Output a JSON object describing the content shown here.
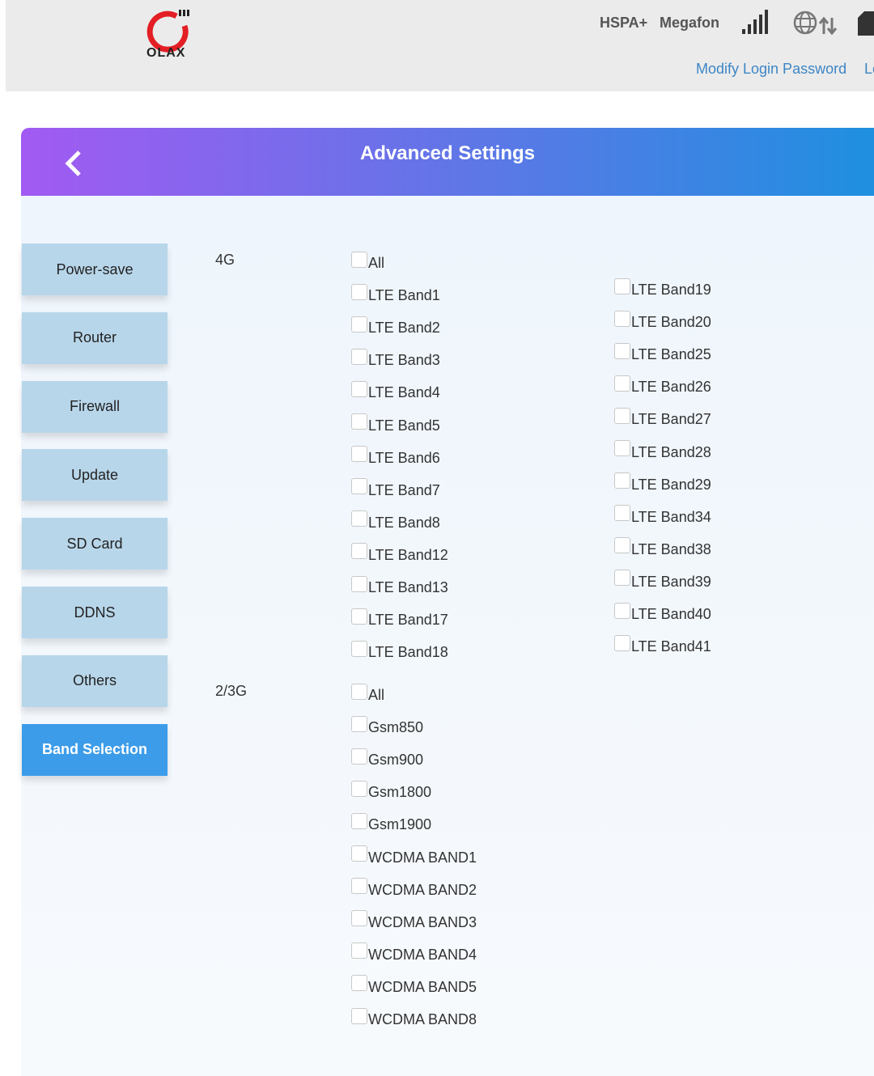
{
  "header": {
    "logo_text": "OLAX",
    "network_type": "HSPA+",
    "operator": "Megafon",
    "signal_icon": "signal-bars-icon",
    "data_icon": "globe-updown-icon",
    "sim_icon": "sim-icon",
    "modify_password_link": "Modify Login Password",
    "logout_link": "Lo"
  },
  "banner": {
    "title": "Advanced Settings",
    "back_icon": "chevron-left-icon"
  },
  "sidebar": {
    "items": [
      {
        "label": "Power-save"
      },
      {
        "label": "Router"
      },
      {
        "label": "Firewall"
      },
      {
        "label": "Update"
      },
      {
        "label": "SD Card"
      },
      {
        "label": "DDNS"
      },
      {
        "label": "Others"
      },
      {
        "label": "Band Selection",
        "active": true
      }
    ]
  },
  "bands": {
    "lte_label": "4G",
    "lte_col1": [
      {
        "label": "All",
        "checked": false
      },
      {
        "label": "LTE Band1",
        "checked": false
      },
      {
        "label": "LTE Band2",
        "checked": false
      },
      {
        "label": "LTE Band3",
        "checked": false
      },
      {
        "label": "LTE Band4",
        "checked": false
      },
      {
        "label": "LTE Band5",
        "checked": false
      },
      {
        "label": "LTE Band6",
        "checked": false
      },
      {
        "label": "LTE Band7",
        "checked": false
      },
      {
        "label": "LTE Band8",
        "checked": false
      },
      {
        "label": "LTE Band12",
        "checked": false
      },
      {
        "label": "LTE Band13",
        "checked": false
      },
      {
        "label": "LTE Band17",
        "checked": false
      },
      {
        "label": "LTE Band18",
        "checked": false
      }
    ],
    "lte_col2": [
      {
        "label": "LTE Band19",
        "checked": false
      },
      {
        "label": "LTE Band20",
        "checked": false
      },
      {
        "label": "LTE Band25",
        "checked": false
      },
      {
        "label": "LTE Band26",
        "checked": false
      },
      {
        "label": "LTE Band27",
        "checked": false
      },
      {
        "label": "LTE Band28",
        "checked": false
      },
      {
        "label": "LTE Band29",
        "checked": false
      },
      {
        "label": "LTE Band34",
        "checked": false
      },
      {
        "label": "LTE Band38",
        "checked": false
      },
      {
        "label": "LTE Band39",
        "checked": false
      },
      {
        "label": "LTE Band40",
        "checked": false
      },
      {
        "label": "LTE Band41",
        "checked": false
      }
    ],
    "g23_label": "2/3G",
    "g23": [
      {
        "label": "All",
        "checked": false
      },
      {
        "label": "Gsm850",
        "checked": false
      },
      {
        "label": "Gsm900",
        "checked": false
      },
      {
        "label": "Gsm1800",
        "checked": false
      },
      {
        "label": "Gsm1900",
        "checked": false
      },
      {
        "label": "WCDMA BAND1",
        "checked": false
      },
      {
        "label": "WCDMA BAND2",
        "checked": false
      },
      {
        "label": "WCDMA BAND3",
        "checked": false
      },
      {
        "label": "WCDMA BAND4",
        "checked": false
      },
      {
        "label": "WCDMA BAND5",
        "checked": false
      },
      {
        "label": "WCDMA BAND8",
        "checked": false
      }
    ]
  }
}
